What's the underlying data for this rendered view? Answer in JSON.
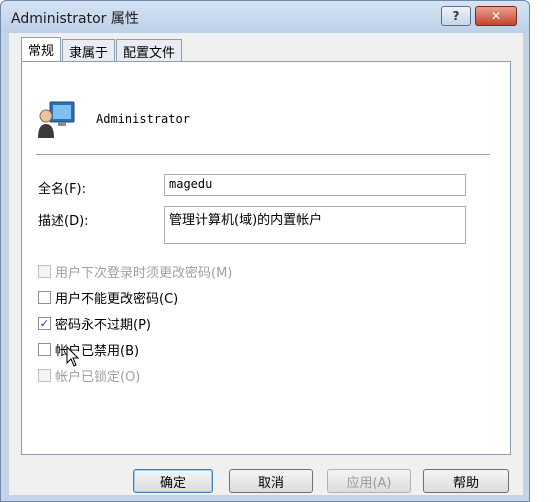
{
  "window": {
    "title": "Administrator 属性",
    "help_glyph": "?",
    "close_glyph": "✕"
  },
  "tabs": [
    {
      "label": "常规",
      "active": true
    },
    {
      "label": "隶属于",
      "active": false
    },
    {
      "label": "配置文件",
      "active": false
    }
  ],
  "general": {
    "user_icon": "user-computer-icon",
    "account_name": "Administrator",
    "fullname_label": "全名(F):",
    "fullname_value": "magedu",
    "description_label": "描述(D):",
    "description_value": "管理计算机(域)的内置帐户"
  },
  "checkboxes": [
    {
      "label": "用户下次登录时须更改密码(M)",
      "checked": false,
      "enabled": false
    },
    {
      "label": "用户不能更改密码(C)",
      "checked": false,
      "enabled": true
    },
    {
      "label": "密码永不过期(P)",
      "checked": true,
      "enabled": true
    },
    {
      "label": "帐户已禁用(B)",
      "checked": false,
      "enabled": true
    },
    {
      "label": "帐户已锁定(O)",
      "checked": false,
      "enabled": false
    }
  ],
  "buttons": {
    "ok": "确定",
    "cancel": "取消",
    "apply": "应用(A)",
    "help": "帮助"
  },
  "colors": {
    "titlebar": "#c3d3e8",
    "check_mark": "#1a3f8e",
    "close_button": "#c4452c"
  }
}
